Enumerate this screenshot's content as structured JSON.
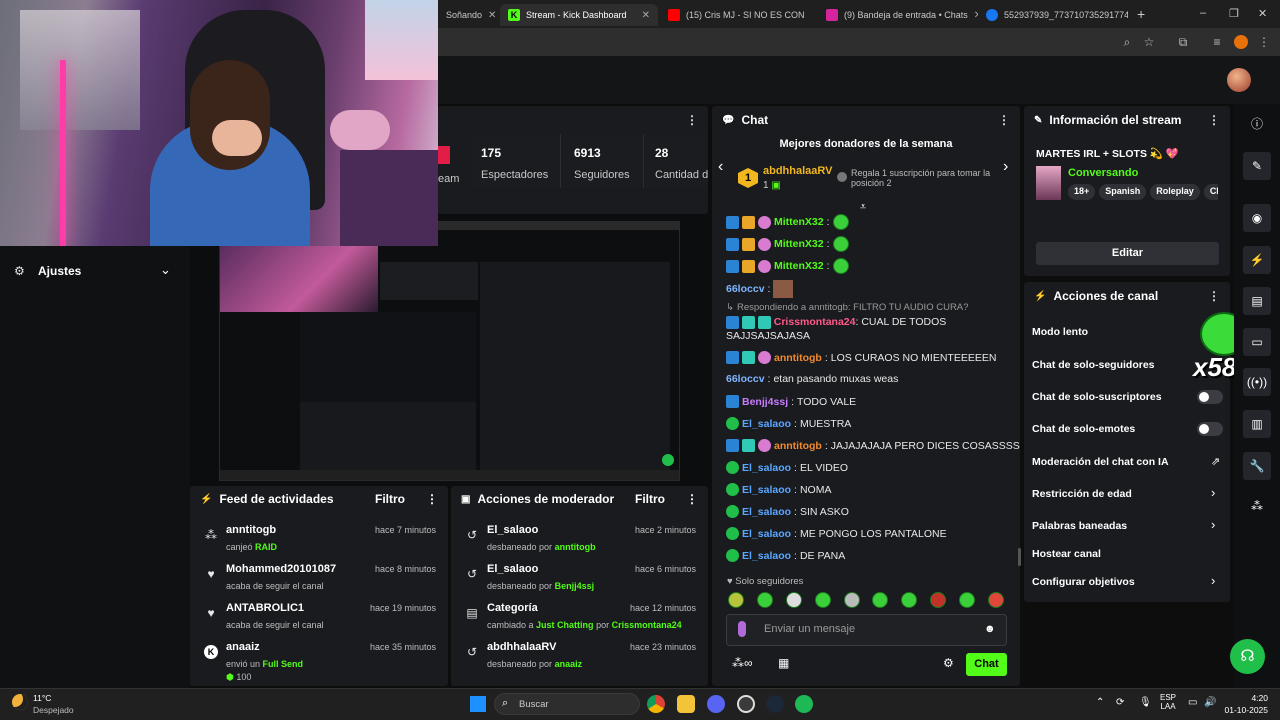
{
  "browser": {
    "tabs": [
      {
        "label": "Soñando",
        "favicon_color": "#c0392b"
      },
      {
        "label": "Stream - Kick Dashboard",
        "favicon_color": "#53fc18"
      },
      {
        "label": "(15) Cris MJ - SI NO ES CON",
        "favicon_color": "#ff0000"
      },
      {
        "label": "(9) Bandeja de entrada • Chats",
        "favicon_color": "#d6249f"
      },
      {
        "label": "552937939_773710735291774...",
        "favicon_color": "#1877f2"
      }
    ],
    "new_tab": "+",
    "window_controls": [
      "–",
      "❐",
      "✕"
    ]
  },
  "stats": {
    "items": [
      {
        "value": "175",
        "label": "Espectadores"
      },
      {
        "value": "6913",
        "label": "Seguidores"
      },
      {
        "value": "28",
        "label": "Cantidad de"
      }
    ],
    "partial_label": "eam"
  },
  "settings": {
    "label": "Ajustes"
  },
  "activity_feed": {
    "title": "Feed de actividades",
    "filter": "Filtro",
    "items": [
      {
        "name": "anntitogb",
        "pre": "canjeó",
        "highlight": "RAID",
        "post": "",
        "time": "hace 7 minutos",
        "icon": "raid-icon"
      },
      {
        "name": "Mohammed20101087",
        "pre": "acaba de seguir el canal",
        "highlight": "",
        "post": "",
        "time": "hace 8 minutos",
        "icon": "heart-icon"
      },
      {
        "name": "ANTABROLIC1",
        "pre": "acaba de seguir el canal",
        "highlight": "",
        "post": "",
        "time": "hace 19 minutos",
        "icon": "heart-icon"
      },
      {
        "name": "anaaiz",
        "pre": "envió un",
        "highlight": "Full Send",
        "post": "",
        "time": "hace 35 minutos",
        "icon": "kick-icon"
      }
    ],
    "partial_value": "100"
  },
  "mod_actions": {
    "title": "Acciones de moderador",
    "filter": "Filtro",
    "items": [
      {
        "name": "El_salaoo",
        "pre": "desbaneado por",
        "by": "anntitogb",
        "post": "",
        "time": "hace 2 minutos",
        "icon": "unban-icon"
      },
      {
        "name": "El_salaoo",
        "pre": "desbaneado por",
        "by": "Benjj4ssj",
        "post": "",
        "time": "hace 6 minutos",
        "icon": "unban-icon"
      },
      {
        "name": "Categoría",
        "pre": "cambiado a",
        "by": "Just Chatting",
        "post": "por",
        "by2": "Crissmontana24",
        "time": "hace 12 minutos",
        "icon": "category-icon"
      },
      {
        "name": "abdhhalaaRV",
        "pre": "desbaneado por",
        "by": "anaaiz",
        "post": "",
        "time": "hace 23 minutos",
        "icon": "unban-icon"
      }
    ]
  },
  "chat": {
    "title": "Chat",
    "donors_title": "Mejores donadores de la semana",
    "top_donor": {
      "rank": "1",
      "name": "abdhhalaaRV",
      "count": "1"
    },
    "gift_cta": "Regala 1 suscripción para tomar la posición 2",
    "reply_hint": "Respondiendo a anntitogb: FILTRO TU AUDIO CURA?",
    "messages": [
      {
        "user": "MittenX32",
        "text": ""
      },
      {
        "user": "MittenX32",
        "text": ""
      },
      {
        "user": "MittenX32",
        "text": ""
      },
      {
        "user": "66loccv",
        "text": ""
      },
      {
        "user": "Crissmontana24",
        "text": "CUAL DE TODOS SAJJSAJSAJASA"
      },
      {
        "user": "anntitogb",
        "text": "LOS CURAOS NO MIENTEEEEEN"
      },
      {
        "user": "66loccv",
        "text": "etan pasando muxas weas"
      },
      {
        "user": "Benjj4ssj",
        "text": "TODO VALE"
      },
      {
        "user": "El_salaoo",
        "text": "MUESTRA"
      },
      {
        "user": "anntitogb",
        "text": "JAJAJAJAJA PERO DICES COSASSSS"
      },
      {
        "user": "El_salaoo",
        "text": "EL VIDEO"
      },
      {
        "user": "El_salaoo",
        "text": "NOMA"
      },
      {
        "user": "El_salaoo",
        "text": "SIN ASKO"
      },
      {
        "user": "El_salaoo",
        "text": "ME PONGO LOS PANTALONE"
      },
      {
        "user": "El_salaoo",
        "text": "DE PANA"
      }
    ],
    "mode_label": "Solo seguidores",
    "input_placeholder": "Enviar un mensaje",
    "send_label": "Chat"
  },
  "stream_info": {
    "title": "Información del stream",
    "stream_title": "MARTES IRL + SLOTS 💫 💖",
    "category": "Conversando",
    "tags": [
      "18+",
      "Spanish",
      "Roleplay",
      "Ch"
    ],
    "edit_label": "Editar"
  },
  "channel_actions": {
    "title": "Acciones de canal",
    "items": [
      {
        "label": "Modo lento",
        "control": "none"
      },
      {
        "label": "Chat de solo-seguidores",
        "control": "none"
      },
      {
        "label": "Chat de solo-suscriptores",
        "control": "toggle"
      },
      {
        "label": "Chat de solo-emotes",
        "control": "toggle"
      },
      {
        "label": "Moderación del chat con IA",
        "control": "external"
      },
      {
        "label": "Restricción de edad",
        "control": "chevron"
      },
      {
        "label": "Palabras baneadas",
        "control": "chevron"
      },
      {
        "label": "Hostear canal",
        "control": "none"
      },
      {
        "label": "Configurar objetivos",
        "control": "chevron"
      }
    ]
  },
  "overlay": {
    "combo": "x58"
  },
  "taskbar": {
    "weather_temp": "11°C",
    "weather_desc": "Despejado",
    "search_placeholder": "Buscar",
    "lang_top": "ESP",
    "lang_bottom": "LAA",
    "time": "4:20",
    "date": "01-10-2025"
  },
  "colors": {
    "kick_green": "#53fc18",
    "panel": "#191b1f",
    "bg": "#0d0d0e"
  }
}
